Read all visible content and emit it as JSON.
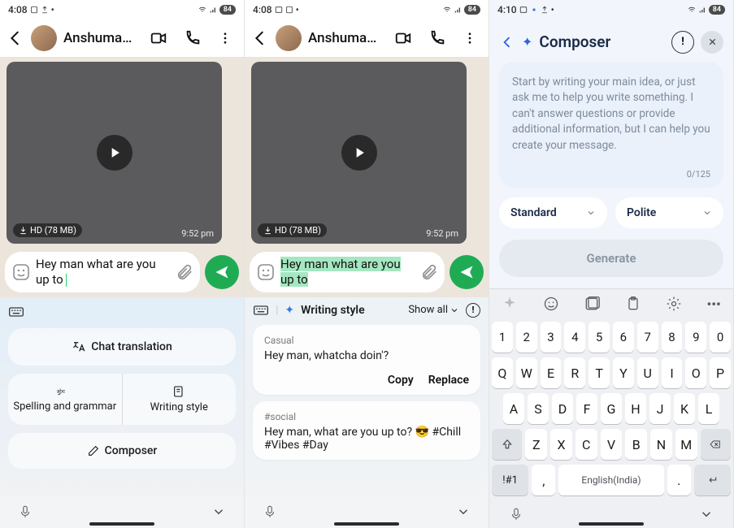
{
  "status": {
    "time1": "4:08",
    "time2": "4:08",
    "time3": "4:10",
    "battery": "84"
  },
  "chat": {
    "contact": "Anshuman Jain (…",
    "hd_label": "HD (78 MB)",
    "video_time": "9:52 pm",
    "message_text": "Hey man what are you up to"
  },
  "assist": {
    "translation": "Chat translation",
    "spelling": "Spelling and grammar",
    "style": "Writing style",
    "composer": "Composer"
  },
  "suggestions": {
    "heading": "Writing style",
    "show_all": "Show all",
    "items": [
      {
        "tag": "Casual",
        "text": "Hey man, whatcha doin'?",
        "copy": "Copy",
        "replace": "Replace"
      },
      {
        "tag": "#social",
        "text": "Hey man, what are you up to? 😎 #Chill #Vibes #Day"
      }
    ]
  },
  "composer": {
    "title": "Composer",
    "placeholder": "Start by writing your main idea, or just ask me to help you write something. I can't answer questions or provide additional information, but I can help you create your message.",
    "counter": "0/125",
    "chip1": "Standard",
    "chip2": "Polite",
    "generate": "Generate",
    "space_label": "English(India)"
  },
  "keys": {
    "row1": [
      "1",
      "2",
      "3",
      "4",
      "5",
      "6",
      "7",
      "8",
      "9",
      "0"
    ],
    "row2": [
      "Q",
      "W",
      "E",
      "R",
      "T",
      "Y",
      "U",
      "I",
      "O",
      "P"
    ],
    "row3": [
      "A",
      "S",
      "D",
      "F",
      "G",
      "H",
      "J",
      "K",
      "L"
    ],
    "row4": [
      "Z",
      "X",
      "C",
      "V",
      "B",
      "N",
      "M"
    ],
    "symkey": "!#1",
    "comma": ",",
    "period": "."
  }
}
